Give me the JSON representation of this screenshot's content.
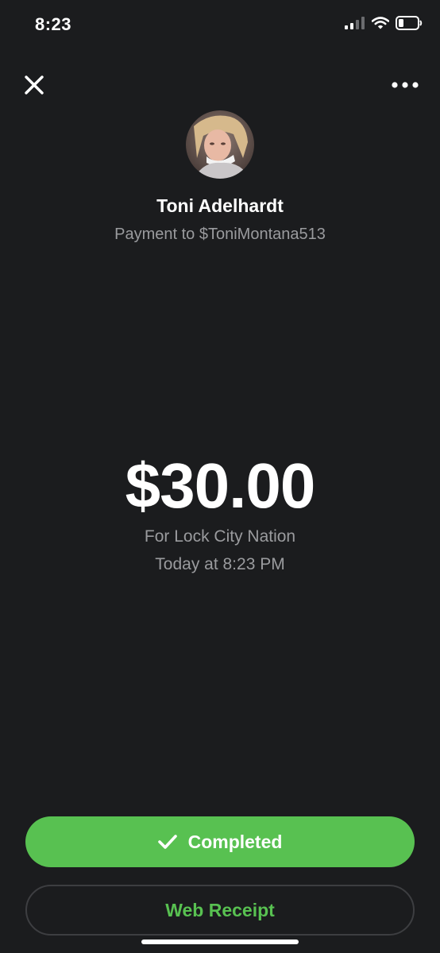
{
  "status_bar": {
    "time": "8:23",
    "icons": [
      "cellular-signal-icon",
      "wifi-icon",
      "battery-icon"
    ]
  },
  "header": {
    "close_icon": "close-icon",
    "more_icon": "more-options-icon"
  },
  "recipient": {
    "name": "Toni Adelhardt",
    "payment_to": "Payment to $ToniMontana513"
  },
  "payment": {
    "amount": "$30.00",
    "note": "For Lock City Nation",
    "timestamp": "Today at 8:23 PM"
  },
  "actions": {
    "completed_label": "Completed",
    "web_receipt_label": "Web Receipt"
  },
  "colors": {
    "background": "#1b1c1e",
    "accent_green": "#58c151",
    "secondary_text": "#9a9b9e"
  }
}
